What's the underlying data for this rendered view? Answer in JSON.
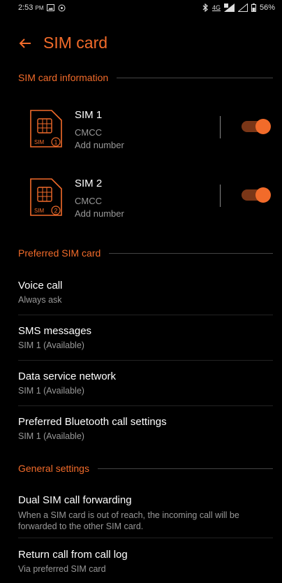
{
  "status_bar": {
    "time": "2:53",
    "ampm": "PM",
    "network": "4G",
    "battery": "56%"
  },
  "header": {
    "title": "SIM card"
  },
  "sections": {
    "sim_info": "SIM card information",
    "preferred": "Preferred SIM card",
    "general": "General settings"
  },
  "sims": [
    {
      "name": "SIM 1",
      "carrier": "CMCC",
      "number": "Add number",
      "icon_label": "SIM",
      "index": "1",
      "enabled": true
    },
    {
      "name": "SIM 2",
      "carrier": "CMCC",
      "number": "Add number",
      "icon_label": "SIM",
      "index": "2",
      "enabled": true
    }
  ],
  "preferred_items": [
    {
      "title": "Voice call",
      "subtitle": "Always ask"
    },
    {
      "title": "SMS messages",
      "subtitle": "SIM 1 (Available)"
    },
    {
      "title": "Data service network",
      "subtitle": "SIM 1 (Available)"
    },
    {
      "title": "Preferred Bluetooth call settings",
      "subtitle": "SIM 1 (Available)"
    }
  ],
  "general_items": [
    {
      "title": "Dual SIM call forwarding",
      "subtitle": "When a SIM card is out of reach, the incoming call will be forwarded to the other SIM card."
    },
    {
      "title": "Return call from call log",
      "subtitle": "Via preferred SIM card"
    }
  ],
  "colors": {
    "accent": "#f26b2a",
    "background": "#000000"
  }
}
